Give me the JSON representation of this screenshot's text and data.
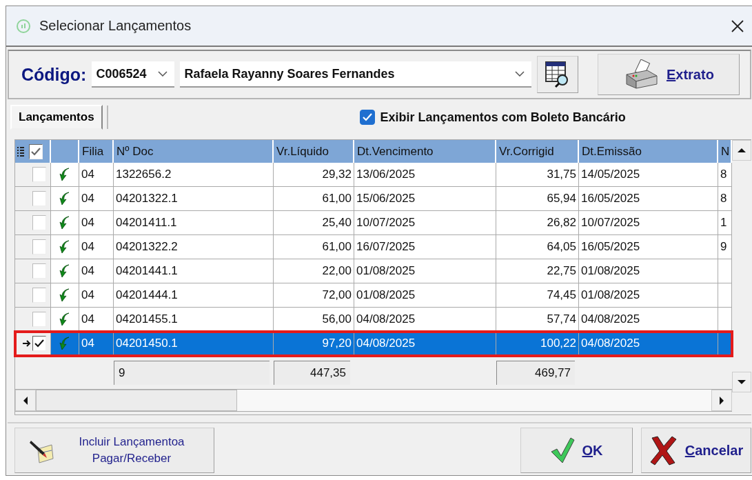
{
  "window": {
    "title": "Selecionar Lançamentos"
  },
  "toolbar": {
    "code_label": "Código:",
    "code_value": "C006524",
    "name_value": "Rafaela Rayanny Soares Fernandes",
    "extrato_button": {
      "label": "Extrato",
      "underline_first": true
    }
  },
  "tabs": [
    {
      "label": "Lançamentos",
      "selected": true
    }
  ],
  "boleto_checkbox": {
    "label": "Exibir Lançamentos com Boleto Bancário",
    "checked": true
  },
  "table": {
    "select_all_checked": true,
    "columns": [
      "Filia",
      "Nº Doc",
      "Vr.Líquido",
      "Dt.Vencimento",
      "Vr.Corrigid",
      "Dt.Emissão",
      "N"
    ],
    "rows": [
      {
        "checked": false,
        "selected": false,
        "annotated": false,
        "cells": [
          "04",
          "1322656.2",
          "29,32",
          "13/06/2025",
          "31,75",
          "14/05/2025",
          "8"
        ]
      },
      {
        "checked": false,
        "selected": false,
        "annotated": false,
        "cells": [
          "04",
          "04201322.1",
          "61,00",
          "15/06/2025",
          "65,94",
          "16/05/2025",
          "8"
        ]
      },
      {
        "checked": false,
        "selected": false,
        "annotated": false,
        "cells": [
          "04",
          "04201411.1",
          "25,40",
          "10/07/2025",
          "26,82",
          "10/07/2025",
          "1"
        ]
      },
      {
        "checked": false,
        "selected": false,
        "annotated": false,
        "cells": [
          "04",
          "04201322.2",
          "61,00",
          "16/07/2025",
          "64,05",
          "16/05/2025",
          "9"
        ]
      },
      {
        "checked": false,
        "selected": false,
        "annotated": false,
        "cells": [
          "04",
          "04201441.1",
          "22,00",
          "01/08/2025",
          "22,75",
          "01/08/2025"
        ]
      },
      {
        "checked": false,
        "selected": false,
        "annotated": false,
        "cells": [
          "04",
          "04201444.1",
          "72,00",
          "01/08/2025",
          "74,45",
          "01/08/2025"
        ]
      },
      {
        "checked": false,
        "selected": false,
        "annotated": false,
        "cells": [
          "04",
          "04201455.1",
          "56,00",
          "04/08/2025",
          "57,74",
          "04/08/2025"
        ]
      },
      {
        "checked": true,
        "selected": true,
        "annotated": true,
        "cells": [
          "04",
          "04201450.1",
          "97,20",
          "04/08/2025",
          "100,22",
          "04/08/2025"
        ]
      }
    ],
    "totals": {
      "count": "9",
      "vr_liquido": "447,35",
      "vr_corrigido": "469,77"
    }
  },
  "buttons": {
    "incluir": {
      "label": "Incluir Lançamentoa Pagar/Receber"
    },
    "ok": {
      "label": "OK",
      "underline_first": true
    },
    "cancelar": {
      "label": "Cancelar",
      "underline_first": true
    }
  }
}
